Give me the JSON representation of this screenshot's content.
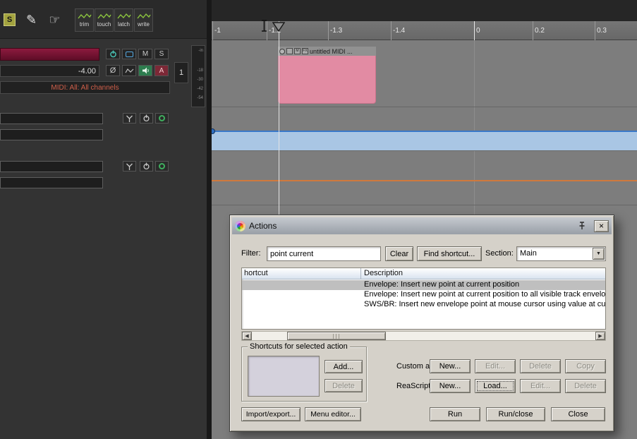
{
  "toolbar": {
    "solo_button": "S",
    "automation_modes": [
      "trim",
      "touch",
      "latch",
      "write"
    ]
  },
  "icons": {
    "pencil": "✎",
    "hand": "☞",
    "close": "×",
    "dropdown_arrow": "▼",
    "scroll_left": "◀",
    "scroll_right": "▶"
  },
  "track_panel": {
    "volume": "-4.00",
    "routing_text": "MIDI: All: All channels",
    "track_number": "1",
    "mute": "M",
    "solo": "S",
    "phase": "Ø",
    "arm": "A",
    "meter_ticks": [
      "-in",
      "-18",
      "-30",
      "-42",
      "-54"
    ]
  },
  "ruler": {
    "labels": [
      "-1",
      "-1.2",
      "-1.3",
      "-1.4",
      "0",
      "0.2",
      "0.3"
    ]
  },
  "midi_item": {
    "title": "untitled MIDI ...",
    "mute_icon": "M",
    "fx_icon": "FX"
  },
  "actions_dialog": {
    "title": "Actions",
    "filter": {
      "label": "Filter:",
      "value": "point current"
    },
    "section": {
      "label": "Section:",
      "value": "Main"
    },
    "buttons": {
      "clear": "Clear",
      "find_shortcut": "Find shortcut...",
      "add": "Add...",
      "delete": "Delete",
      "import_export": "Import/export...",
      "menu_editor": "Menu editor...",
      "run": "Run",
      "run_close": "Run/close",
      "close": "Close"
    },
    "list": {
      "columns": {
        "shortcut": "hortcut",
        "description": "Description"
      },
      "rows": [
        "Envelope: Insert new point at current position",
        "Envelope: Insert new point at current position to all visible track envelope",
        "SWS/BR: Insert new envelope point at mouse cursor using value at cur"
      ]
    },
    "shortcuts_group_label": "Shortcuts for selected action",
    "custom_actions": {
      "label": "Custom actions:",
      "new": "New...",
      "edit": "Edit...",
      "delete": "Delete",
      "copy": "Copy"
    },
    "reascript": {
      "label": "ReaScript:",
      "new": "New...",
      "load": "Load...",
      "edit": "Edit...",
      "delete": "Delete"
    }
  }
}
